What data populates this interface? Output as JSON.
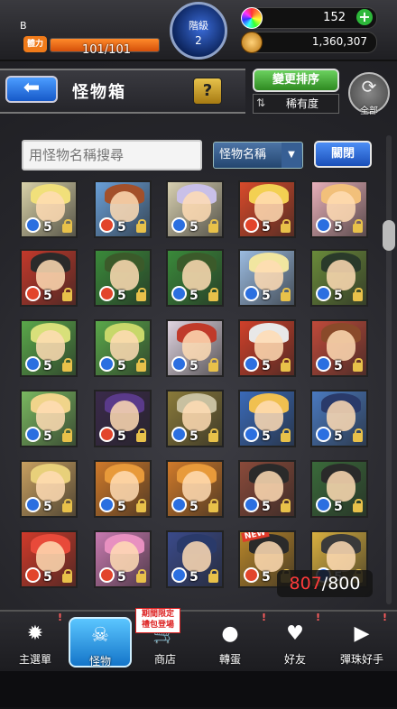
{
  "status_bar": {
    "rank_letter": "B",
    "stamina_label": "體力",
    "stamina_text": "101/101",
    "stamina_fraction": 1.0,
    "rank_label": "階級",
    "rank_value": "2",
    "gems": "152",
    "gold": "1,360,307"
  },
  "header": {
    "back_glyph": "⬅",
    "title": "怪物箱",
    "help_glyph": "?",
    "sort_button": "變更排序",
    "sort_order": "稀有度",
    "all_label": "全部"
  },
  "search": {
    "placeholder": "用怪物名稱搜尋",
    "select_value": "怪物名稱",
    "close_label": "關閉"
  },
  "monsters": [
    {
      "bg": "#d9d2a8",
      "hair": "#f1e07a",
      "element": "water",
      "level": "5",
      "badge": ""
    },
    {
      "bg": "#6aa0d8",
      "hair": "#a3502a",
      "element": "fire",
      "level": "5",
      "badge": ""
    },
    {
      "bg": "#d8d0b0",
      "hair": "#c9c0e8",
      "element": "water",
      "level": "5",
      "badge": ""
    },
    {
      "bg": "#d94a2a",
      "hair": "#f3d052",
      "element": "fire",
      "level": "5",
      "badge": ""
    },
    {
      "bg": "#e8b0b8",
      "hair": "#f2c07a",
      "element": "water",
      "level": "5",
      "badge": ""
    },
    {
      "bg": "#c3392b",
      "hair": "#2a2a2a",
      "element": "fire",
      "level": "5",
      "badge": ""
    },
    {
      "bg": "#3a8a3a",
      "hair": "#3b5a2a",
      "element": "fire",
      "level": "5",
      "badge": ""
    },
    {
      "bg": "#3a8a3a",
      "hair": "#3b5a2a",
      "element": "water",
      "level": "5",
      "badge": ""
    },
    {
      "bg": "#9bbbe0",
      "hair": "#f1e6a0",
      "element": "water",
      "level": "5",
      "badge": ""
    },
    {
      "bg": "#6a8a3a",
      "hair": "#2a3a2a",
      "element": "water",
      "level": "5",
      "badge": ""
    },
    {
      "bg": "#5aa84a",
      "hair": "#d8e07a",
      "element": "water",
      "level": "5",
      "badge": ""
    },
    {
      "bg": "#5aa84a",
      "hair": "#c8d86a",
      "element": "water",
      "level": "5",
      "badge": ""
    },
    {
      "bg": "#e0d4e0",
      "hair": "#c03a2a",
      "element": "water",
      "level": "5",
      "badge": ""
    },
    {
      "bg": "#d0402a",
      "hair": "#e8e8e8",
      "element": "water",
      "level": "5",
      "badge": ""
    },
    {
      "bg": "#c04a3a",
      "hair": "#8a4a2a",
      "element": "water",
      "level": "5",
      "badge": ""
    },
    {
      "bg": "#7ab860",
      "hair": "#f0d48a",
      "element": "water",
      "level": "5",
      "badge": ""
    },
    {
      "bg": "#3a2a4a",
      "hair": "#5a3a8a",
      "element": "fire",
      "level": "5",
      "badge": ""
    },
    {
      "bg": "#8a7a3a",
      "hair": "#c8c0a0",
      "element": "water",
      "level": "5",
      "badge": ""
    },
    {
      "bg": "#3a6ab8",
      "hair": "#f0c050",
      "element": "water",
      "level": "5",
      "badge": ""
    },
    {
      "bg": "#4a7ac0",
      "hair": "#2a3a6a",
      "element": "water",
      "level": "5",
      "badge": ""
    },
    {
      "bg": "#c8a060",
      "hair": "#e8d07a",
      "element": "water",
      "level": "5",
      "badge": ""
    },
    {
      "bg": "#d07a2a",
      "hair": "#e89a3a",
      "element": "water",
      "level": "5",
      "badge": ""
    },
    {
      "bg": "#d07a2a",
      "hair": "#e89a3a",
      "element": "water",
      "level": "5",
      "badge": ""
    },
    {
      "bg": "#8a4a3a",
      "hair": "#2a2a2a",
      "element": "water",
      "level": "5",
      "badge": ""
    },
    {
      "bg": "#3a6a3a",
      "hair": "#2a2a2a",
      "element": "water",
      "level": "5",
      "badge": ""
    },
    {
      "bg": "#d03a2a",
      "hair": "#e84a3a",
      "element": "fire",
      "level": "5",
      "badge": ""
    },
    {
      "bg": "#c87ab0",
      "hair": "#e890c0",
      "element": "fire",
      "level": "5",
      "badge": ""
    },
    {
      "bg": "#3a4a8a",
      "hair": "#2a3a6a",
      "element": "water",
      "level": "5",
      "badge": ""
    },
    {
      "bg": "#b8862a",
      "hair": "#2a2a2a",
      "element": "fire",
      "level": "5",
      "badge": "NEW"
    },
    {
      "bg": "#d8b040",
      "hair": "#3a3a3a",
      "element": "water",
      "level": "5",
      "badge": ""
    }
  ],
  "box": {
    "current": "807",
    "max": "/800"
  },
  "nav": [
    {
      "label": "主選單",
      "icon": "✹",
      "active": false
    },
    {
      "label": "怪物",
      "icon": "☠",
      "active": true
    },
    {
      "label": "商店",
      "icon": "🛒",
      "active": false
    },
    {
      "label": "轉蛋",
      "icon": "●",
      "active": false
    },
    {
      "label": "好友",
      "icon": "♥",
      "active": false
    },
    {
      "label": "彈珠好手",
      "icon": "▶",
      "active": false
    }
  ],
  "promo": "期間限定 禮包登場",
  "colors": {
    "fire": "#e2452b",
    "water": "#2b6fe0",
    "accent": "#2db83a",
    "new_badge": "#e03a2a",
    "count_over": "#ff3b3b"
  }
}
